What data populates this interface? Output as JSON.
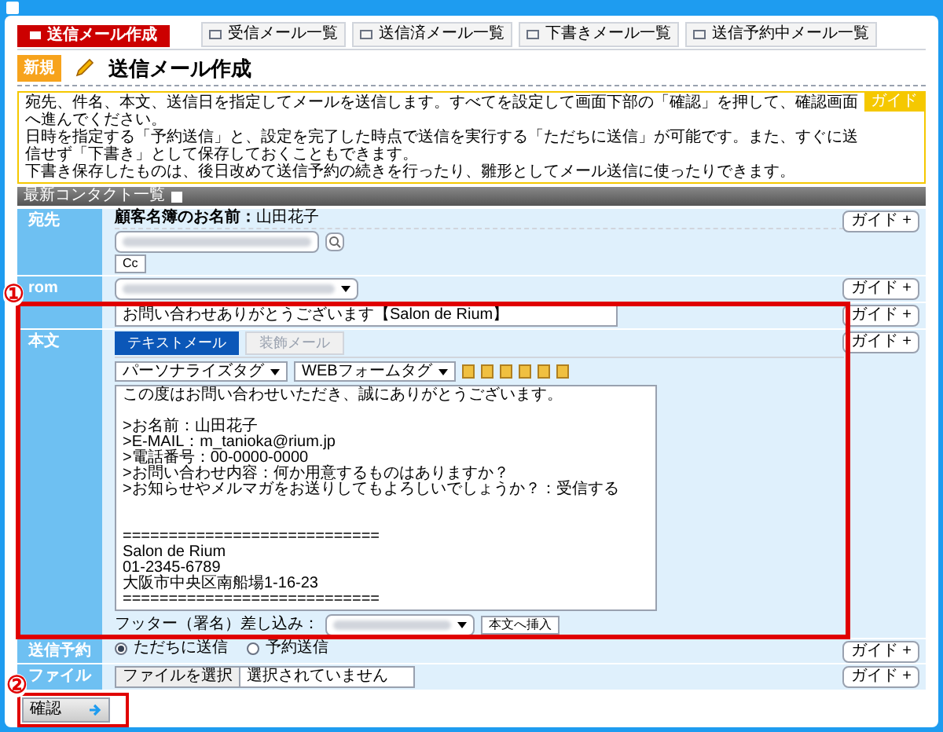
{
  "compose_button": "送信メール作成",
  "tabs": [
    {
      "label": "受信メール一覧",
      "selected": false
    },
    {
      "label": "送信済メール一覧",
      "selected": false
    },
    {
      "label": "下書きメール一覧",
      "selected": false
    },
    {
      "label": "送信予約中メール一覧",
      "selected": false
    }
  ],
  "badge": "新規",
  "heading": "送信メール作成",
  "notice": {
    "guide": "ガイド",
    "lines": [
      "宛先、件名、本文、送信日を指定してメールを送信します。すべてを設定して画面下部の「確認」を押して、確認画面へ進んでください。",
      "日時を指定する「予約送信」と、設定を完了した時点で送信を実行する「ただちに送信」が可能です。また、すぐに送信せず「下書き」として保存しておくこともできます。",
      "下書き保存したものは、後日改めて送信予約の続きを行ったり、雛形としてメール送信に使ったりできます。"
    ]
  },
  "contact_bar": "最新コンタクト一覧",
  "to": {
    "label": "宛先",
    "name_label": "顧客名簿のお名前：",
    "name": "山田花子",
    "cc": "Cc",
    "guide": "ガイド +"
  },
  "from": {
    "label": "rom",
    "guide": "ガイド +"
  },
  "subject": {
    "value": "お問い合わせありがとうございます【Salon de Rium】",
    "guide": "ガイド +"
  },
  "body": {
    "label": "本文",
    "guide": "ガイド +",
    "modes": [
      {
        "label": "テキストメール",
        "selected": true
      },
      {
        "label": "装飾メール",
        "selected": false
      }
    ],
    "tag_selects": [
      "パーソナライズタグ",
      "WEBフォームタグ"
    ],
    "text": "この度はお問い合わせいただき、誠にありがとうございます。\n\n>お名前：山田花子\n>E-MAIL：m_tanioka@rium.jp\n>電話番号：00-0000-0000\n>お問い合わせ内容：何か用意するものはありますか？\n>お知らせやメルマガをお送りしてもよろしいでしょうか？：受信する\n\n\n============================\nSalon de Rium\n01-2345-6789\n大阪市中央区南船場1-16-23\n============================",
    "footer_label": "フッター（署名）差し込み：",
    "insert_button": "本文へ挿入"
  },
  "schedule": {
    "label": "送信予約",
    "guide": "ガイド +",
    "options": [
      {
        "label": "ただちに送信",
        "selected": true
      },
      {
        "label": "予約送信",
        "selected": false
      }
    ]
  },
  "attachment": {
    "label": "ファイル",
    "button": "ファイルを選択",
    "status": "選択されていません",
    "guide": "ガイド +"
  },
  "confirm": "確認",
  "callouts": [
    "①",
    "②"
  ]
}
